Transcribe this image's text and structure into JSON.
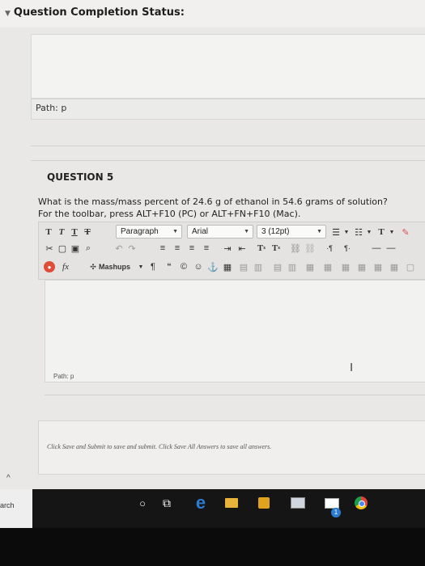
{
  "status": {
    "title": "Question Completion Status:"
  },
  "prev_path": {
    "label": "Path: p"
  },
  "question": {
    "title": "QUESTION 5",
    "text": "What is the mass/mass percent of 24.6 g of ethanol in 54.6 grams of solution?",
    "hint": "For the toolbar, press ALT+F10 (PC) or ALT+FN+F10 (Mac)."
  },
  "toolbar": {
    "format_label": "Paragraph",
    "font_label": "Arial",
    "size_label": "3 (12pt)",
    "mashups_label": "Mashups",
    "text_icons": [
      "T",
      "T",
      "T",
      "T"
    ],
    "superscript": "T",
    "subscript": "T"
  },
  "editor": {
    "path_label": "Path: p"
  },
  "footer": {
    "submit_text": "Click Save and Submit to save and submit. Click Save All Answers to save all answers."
  },
  "taskbar": {
    "search_text": "arch",
    "badge_count": "1"
  },
  "colors": {
    "edge": "#2b7cd3",
    "chrome_red": "#e2443a",
    "chrome_yellow": "#f4c20d",
    "chrome_green": "#1e9e4a",
    "store": "#e1a21f"
  }
}
